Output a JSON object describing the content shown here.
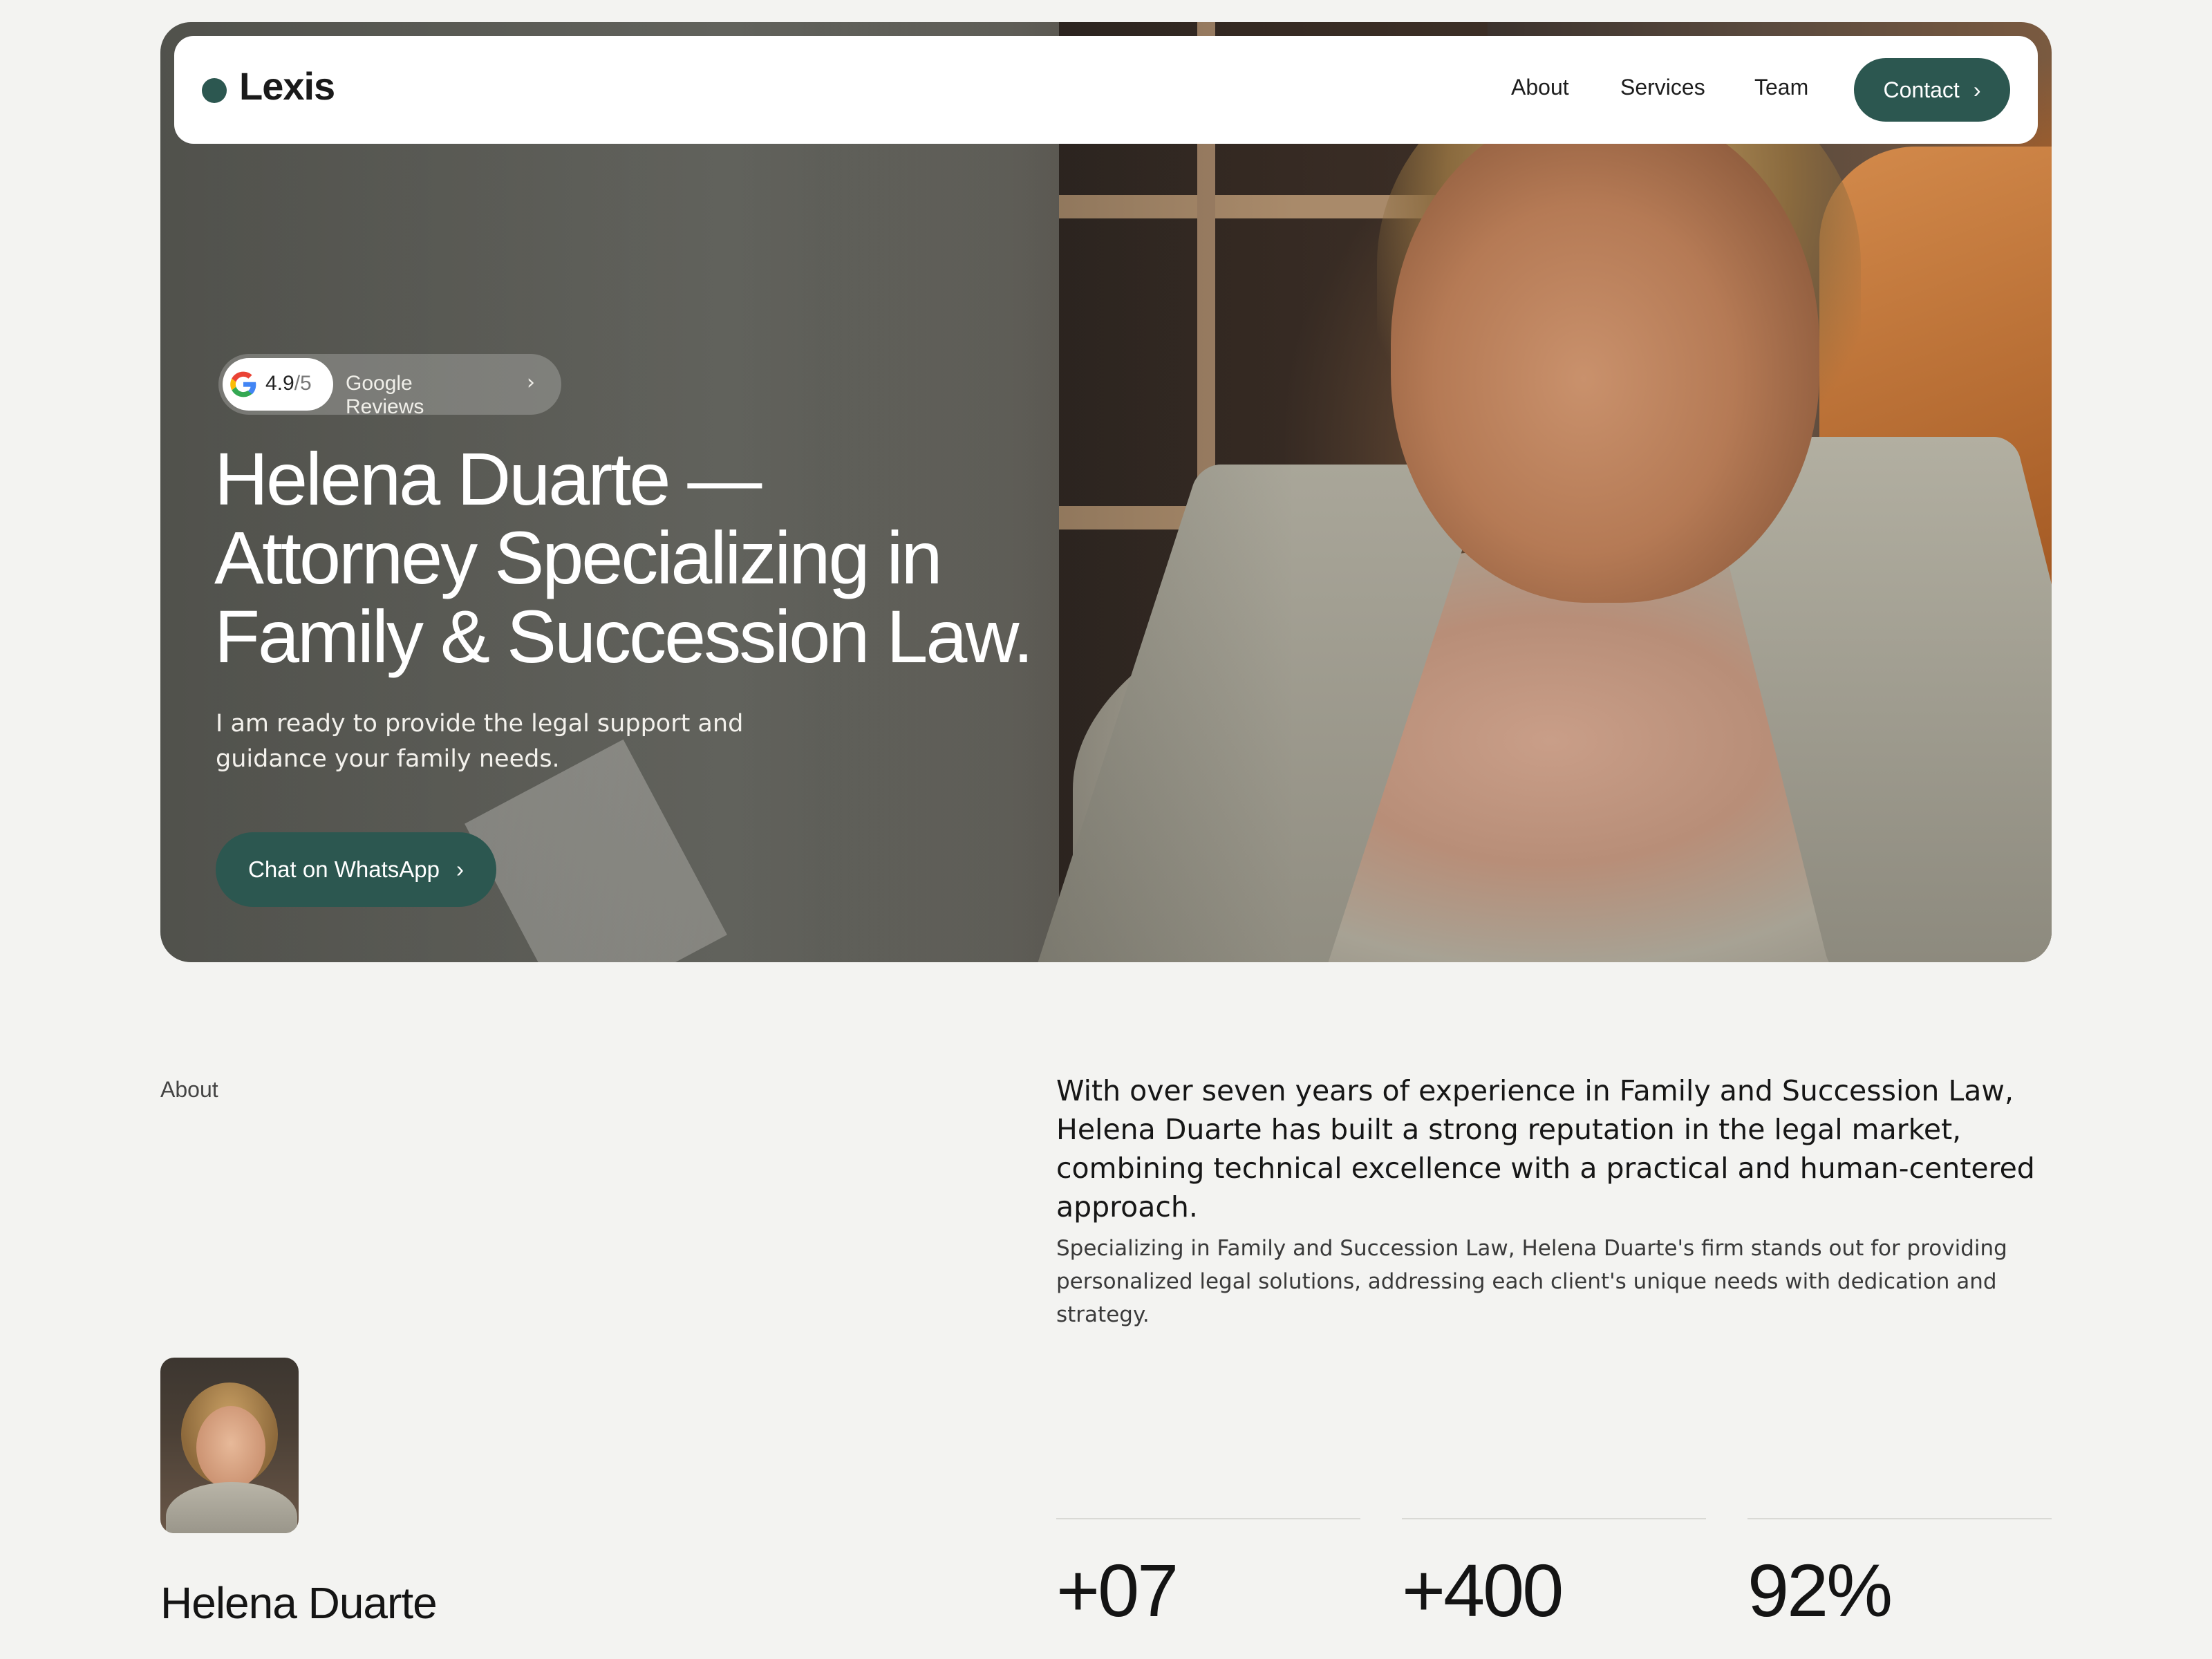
{
  "nav": {
    "logo": "Lexis",
    "links": [
      "About",
      "Services",
      "Team"
    ],
    "contact_label": "Contact",
    "contact_chevron": "›"
  },
  "hero": {
    "rating_value": "4.9",
    "rating_scale": "/5",
    "reviews_label": "Google Reviews",
    "reviews_chevron": "›",
    "title_lines": [
      "Helena Duarte —",
      "Attorney Specializing in",
      "Family & Succession Law."
    ],
    "subtitle": "I am ready to provide the legal support and guidance your family needs.",
    "cta_label": "Chat on WhatsApp",
    "cta_chevron": "›"
  },
  "about": {
    "label": "About",
    "lead": "With over seven years of experience in Family and Succession Law, Helena Duarte has built a strong reputation in the legal market, combining technical excellence with a practical and human-centered approach.",
    "body": "Specializing in Family and Succession Law, Helena Duarte's firm stands out for providing personalized legal solutions, addressing each client's unique needs with dedication and strategy.",
    "name": "Helena Duarte"
  },
  "stats": [
    {
      "value": "+07"
    },
    {
      "value": "+400"
    },
    {
      "value": "92%"
    }
  ],
  "colors": {
    "accent": "#2c5750",
    "background": "#f3f3f1"
  },
  "icons": {
    "google": "google-icon",
    "chevron": "chevron-right-icon",
    "logo_dot": "logo-dot-icon"
  }
}
